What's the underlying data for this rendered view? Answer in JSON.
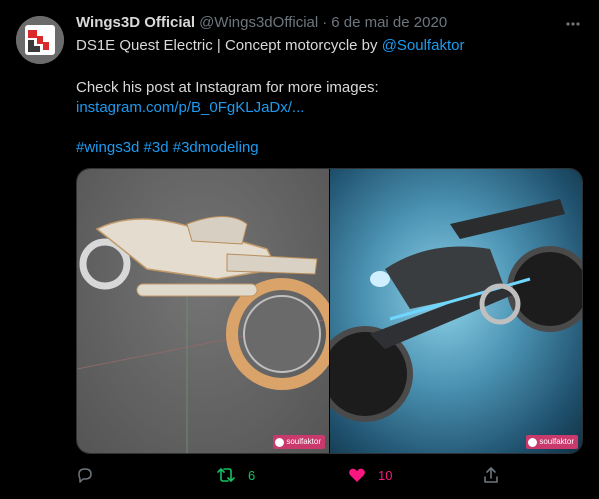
{
  "tweet": {
    "author_name": "Wings3D Official",
    "handle": "@Wings3dOfficial",
    "separator": "·",
    "date": "6 de mai de 2020",
    "line1_text": "DS1E Quest Electric | Concept motorcycle by ",
    "line1_mention": "@Soulfaktor",
    "line2_text": "Check his post at Instagram for more images:",
    "link": "instagram.com/p/B_0FgKLJaDx/...",
    "hashtags": "#wings3d #3d #3dmodeling",
    "watermark_left": "soulfaktor",
    "watermark_right": "soulfaktor"
  },
  "actions": {
    "retweet_count": "6",
    "like_count": "10"
  },
  "colors": {
    "background": "#000000",
    "text": "#d9d9d9",
    "muted": "#6e767d",
    "link": "#1d9bf0",
    "retweet": "#17bf63",
    "like": "#f91880"
  },
  "icons": [
    "wings3d-logo-icon",
    "more-icon",
    "reply-icon",
    "retweet-icon",
    "heart-icon",
    "share-icon"
  ]
}
